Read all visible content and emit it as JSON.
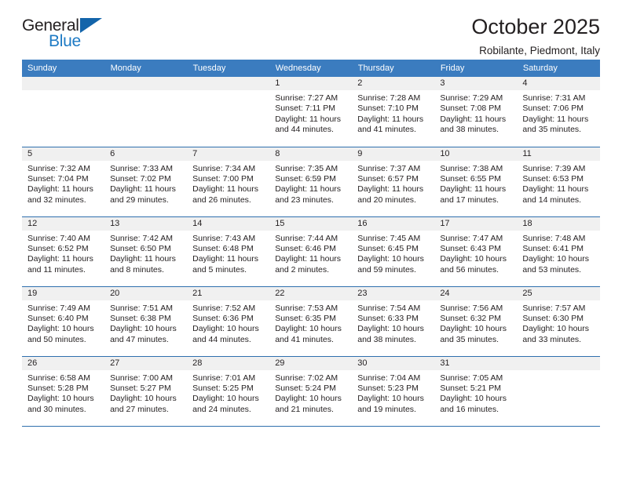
{
  "brand": {
    "name_top": "General",
    "name_bottom": "Blue",
    "accent_color": "#1d7ac4",
    "triangle_color": "#1364aa"
  },
  "header": {
    "title": "October 2025",
    "subtitle": "Robilante, Piedmont, Italy"
  },
  "calendar": {
    "header_bg": "#3b7cbf",
    "daynum_bg": "#f0f0f0",
    "weekdays": [
      "Sunday",
      "Monday",
      "Tuesday",
      "Wednesday",
      "Thursday",
      "Friday",
      "Saturday"
    ],
    "weeks": [
      [
        {
          "day": "",
          "blank": true
        },
        {
          "day": "",
          "blank": true
        },
        {
          "day": "",
          "blank": true
        },
        {
          "day": "1",
          "sunrise": "Sunrise: 7:27 AM",
          "sunset": "Sunset: 7:11 PM",
          "daylight1": "Daylight: 11 hours",
          "daylight2": "and 44 minutes."
        },
        {
          "day": "2",
          "sunrise": "Sunrise: 7:28 AM",
          "sunset": "Sunset: 7:10 PM",
          "daylight1": "Daylight: 11 hours",
          "daylight2": "and 41 minutes."
        },
        {
          "day": "3",
          "sunrise": "Sunrise: 7:29 AM",
          "sunset": "Sunset: 7:08 PM",
          "daylight1": "Daylight: 11 hours",
          "daylight2": "and 38 minutes."
        },
        {
          "day": "4",
          "sunrise": "Sunrise: 7:31 AM",
          "sunset": "Sunset: 7:06 PM",
          "daylight1": "Daylight: 11 hours",
          "daylight2": "and 35 minutes."
        }
      ],
      [
        {
          "day": "5",
          "sunrise": "Sunrise: 7:32 AM",
          "sunset": "Sunset: 7:04 PM",
          "daylight1": "Daylight: 11 hours",
          "daylight2": "and 32 minutes."
        },
        {
          "day": "6",
          "sunrise": "Sunrise: 7:33 AM",
          "sunset": "Sunset: 7:02 PM",
          "daylight1": "Daylight: 11 hours",
          "daylight2": "and 29 minutes."
        },
        {
          "day": "7",
          "sunrise": "Sunrise: 7:34 AM",
          "sunset": "Sunset: 7:00 PM",
          "daylight1": "Daylight: 11 hours",
          "daylight2": "and 26 minutes."
        },
        {
          "day": "8",
          "sunrise": "Sunrise: 7:35 AM",
          "sunset": "Sunset: 6:59 PM",
          "daylight1": "Daylight: 11 hours",
          "daylight2": "and 23 minutes."
        },
        {
          "day": "9",
          "sunrise": "Sunrise: 7:37 AM",
          "sunset": "Sunset: 6:57 PM",
          "daylight1": "Daylight: 11 hours",
          "daylight2": "and 20 minutes."
        },
        {
          "day": "10",
          "sunrise": "Sunrise: 7:38 AM",
          "sunset": "Sunset: 6:55 PM",
          "daylight1": "Daylight: 11 hours",
          "daylight2": "and 17 minutes."
        },
        {
          "day": "11",
          "sunrise": "Sunrise: 7:39 AM",
          "sunset": "Sunset: 6:53 PM",
          "daylight1": "Daylight: 11 hours",
          "daylight2": "and 14 minutes."
        }
      ],
      [
        {
          "day": "12",
          "sunrise": "Sunrise: 7:40 AM",
          "sunset": "Sunset: 6:52 PM",
          "daylight1": "Daylight: 11 hours",
          "daylight2": "and 11 minutes."
        },
        {
          "day": "13",
          "sunrise": "Sunrise: 7:42 AM",
          "sunset": "Sunset: 6:50 PM",
          "daylight1": "Daylight: 11 hours",
          "daylight2": "and 8 minutes."
        },
        {
          "day": "14",
          "sunrise": "Sunrise: 7:43 AM",
          "sunset": "Sunset: 6:48 PM",
          "daylight1": "Daylight: 11 hours",
          "daylight2": "and 5 minutes."
        },
        {
          "day": "15",
          "sunrise": "Sunrise: 7:44 AM",
          "sunset": "Sunset: 6:46 PM",
          "daylight1": "Daylight: 11 hours",
          "daylight2": "and 2 minutes."
        },
        {
          "day": "16",
          "sunrise": "Sunrise: 7:45 AM",
          "sunset": "Sunset: 6:45 PM",
          "daylight1": "Daylight: 10 hours",
          "daylight2": "and 59 minutes."
        },
        {
          "day": "17",
          "sunrise": "Sunrise: 7:47 AM",
          "sunset": "Sunset: 6:43 PM",
          "daylight1": "Daylight: 10 hours",
          "daylight2": "and 56 minutes."
        },
        {
          "day": "18",
          "sunrise": "Sunrise: 7:48 AM",
          "sunset": "Sunset: 6:41 PM",
          "daylight1": "Daylight: 10 hours",
          "daylight2": "and 53 minutes."
        }
      ],
      [
        {
          "day": "19",
          "sunrise": "Sunrise: 7:49 AM",
          "sunset": "Sunset: 6:40 PM",
          "daylight1": "Daylight: 10 hours",
          "daylight2": "and 50 minutes."
        },
        {
          "day": "20",
          "sunrise": "Sunrise: 7:51 AM",
          "sunset": "Sunset: 6:38 PM",
          "daylight1": "Daylight: 10 hours",
          "daylight2": "and 47 minutes."
        },
        {
          "day": "21",
          "sunrise": "Sunrise: 7:52 AM",
          "sunset": "Sunset: 6:36 PM",
          "daylight1": "Daylight: 10 hours",
          "daylight2": "and 44 minutes."
        },
        {
          "day": "22",
          "sunrise": "Sunrise: 7:53 AM",
          "sunset": "Sunset: 6:35 PM",
          "daylight1": "Daylight: 10 hours",
          "daylight2": "and 41 minutes."
        },
        {
          "day": "23",
          "sunrise": "Sunrise: 7:54 AM",
          "sunset": "Sunset: 6:33 PM",
          "daylight1": "Daylight: 10 hours",
          "daylight2": "and 38 minutes."
        },
        {
          "day": "24",
          "sunrise": "Sunrise: 7:56 AM",
          "sunset": "Sunset: 6:32 PM",
          "daylight1": "Daylight: 10 hours",
          "daylight2": "and 35 minutes."
        },
        {
          "day": "25",
          "sunrise": "Sunrise: 7:57 AM",
          "sunset": "Sunset: 6:30 PM",
          "daylight1": "Daylight: 10 hours",
          "daylight2": "and 33 minutes."
        }
      ],
      [
        {
          "day": "26",
          "sunrise": "Sunrise: 6:58 AM",
          "sunset": "Sunset: 5:28 PM",
          "daylight1": "Daylight: 10 hours",
          "daylight2": "and 30 minutes."
        },
        {
          "day": "27",
          "sunrise": "Sunrise: 7:00 AM",
          "sunset": "Sunset: 5:27 PM",
          "daylight1": "Daylight: 10 hours",
          "daylight2": "and 27 minutes."
        },
        {
          "day": "28",
          "sunrise": "Sunrise: 7:01 AM",
          "sunset": "Sunset: 5:25 PM",
          "daylight1": "Daylight: 10 hours",
          "daylight2": "and 24 minutes."
        },
        {
          "day": "29",
          "sunrise": "Sunrise: 7:02 AM",
          "sunset": "Sunset: 5:24 PM",
          "daylight1": "Daylight: 10 hours",
          "daylight2": "and 21 minutes."
        },
        {
          "day": "30",
          "sunrise": "Sunrise: 7:04 AM",
          "sunset": "Sunset: 5:23 PM",
          "daylight1": "Daylight: 10 hours",
          "daylight2": "and 19 minutes."
        },
        {
          "day": "31",
          "sunrise": "Sunrise: 7:05 AM",
          "sunset": "Sunset: 5:21 PM",
          "daylight1": "Daylight: 10 hours",
          "daylight2": "and 16 minutes."
        },
        {
          "day": "",
          "blank": true
        }
      ]
    ]
  }
}
